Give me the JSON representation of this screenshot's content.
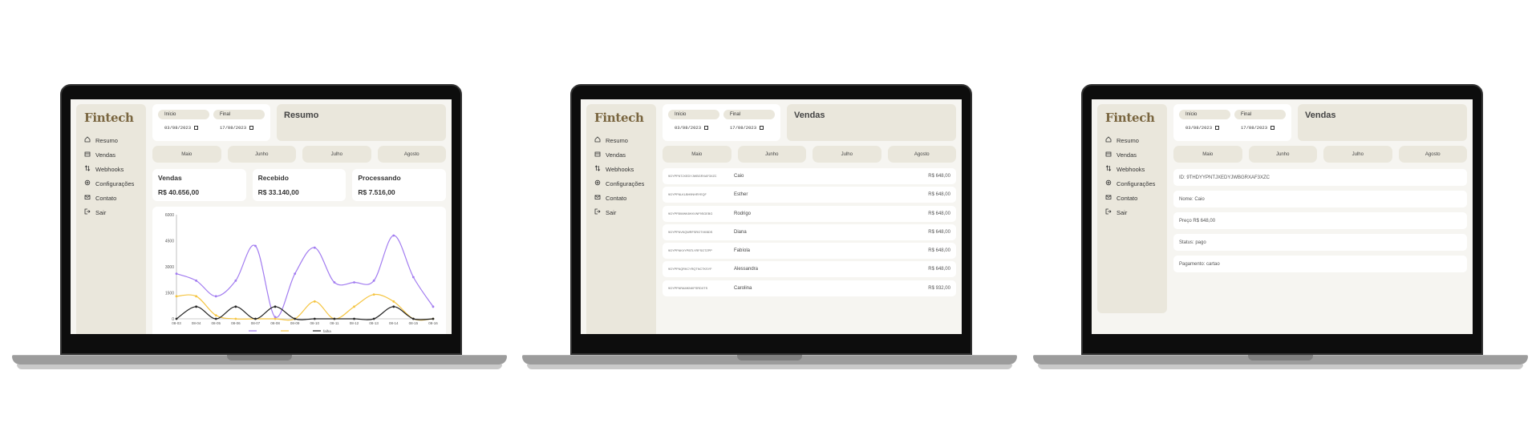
{
  "app": {
    "logo": "Fintech"
  },
  "nav": [
    {
      "label": "Resumo",
      "icon": "home-icon"
    },
    {
      "label": "Vendas",
      "icon": "sales-icon"
    },
    {
      "label": "Webhooks",
      "icon": "webhook-arrows-icon"
    },
    {
      "label": "Configurações",
      "icon": "gear-icon"
    },
    {
      "label": "Contato",
      "icon": "mail-icon"
    },
    {
      "label": "Sair",
      "icon": "logout-icon"
    }
  ],
  "filters": {
    "start_label": "Início",
    "start_value": "03/08/2023",
    "end_label": "Final",
    "end_value": "17/08/2023"
  },
  "months": [
    "Maio",
    "Junho",
    "Julho",
    "Agosto"
  ],
  "screen1": {
    "title": "Resumo",
    "cards": [
      {
        "title": "Vendas",
        "value": "R$ 40.656,00"
      },
      {
        "title": "Recebido",
        "value": "R$ 33.140,00"
      },
      {
        "title": "Processando",
        "value": "R$ 7.516,00"
      }
    ]
  },
  "screen2": {
    "title": "Vendas",
    "rows": [
      {
        "id": "9GYPFNTJXEDYJWBGRXAF3XZC",
        "name": "Caio",
        "price": "R$ 648,00"
      },
      {
        "id": "9GYPFNLKLBH9NHRYEQF",
        "name": "Esther",
        "price": "R$ 648,00"
      },
      {
        "id": "9GYPFBWWK8HXVNF9SGEBG",
        "name": "Rodrigo",
        "price": "R$ 648,00"
      },
      {
        "id": "9GYPFNVKQWRFSRGTXKBDS",
        "name": "Diana",
        "price": "R$ 648,00"
      },
      {
        "id": "9GYPFNKVYPBTLYRFSGTZPP",
        "name": "Fabíola",
        "price": "R$ 648,00"
      },
      {
        "id": "9GYPFNQRKCYRQTNCTKSYF",
        "name": "Alessandra",
        "price": "R$ 648,00"
      },
      {
        "id": "9GYPFNRAMKNKFSRDXTS",
        "name": "Carolina",
        "price": "R$ 932,00"
      }
    ]
  },
  "screen3": {
    "title": "Vendas",
    "rows": [
      "ID: 9THDYYPNTJXEDYJWBGRXAF3XZC",
      "Nome: Caio",
      "Preço R$ 648,00",
      "Status: pago",
      "Pagamento: cartao"
    ]
  },
  "chart_data": {
    "type": "line",
    "x": [
      "08-03",
      "08-04",
      "08-05",
      "08-06",
      "08-07",
      "08-08",
      "08-09",
      "08-10",
      "08-11",
      "08-12",
      "08-13",
      "08-14",
      "08-15",
      "08-16"
    ],
    "y_ticks": [
      0,
      1500,
      3000,
      4500,
      6000
    ],
    "ylim": [
      0,
      6000
    ],
    "series": [
      {
        "name": "",
        "color": "#a27cf0",
        "values": [
          2600,
          2200,
          1300,
          2200,
          4200,
          100,
          2600,
          4100,
          2100,
          2100,
          2200,
          4800,
          2400,
          700
        ]
      },
      {
        "name": "",
        "color": "#f5c542",
        "values": [
          1300,
          1300,
          200,
          0,
          0,
          0,
          0,
          1000,
          0,
          700,
          1400,
          1000,
          0,
          0
        ]
      },
      {
        "name": "falha",
        "color": "#222222",
        "values": [
          0,
          700,
          0,
          700,
          0,
          700,
          0,
          0,
          0,
          0,
          0,
          700,
          0,
          0
        ]
      }
    ],
    "legend": [
      {
        "label": "",
        "color": "#a27cf0"
      },
      {
        "label": "",
        "color": "#f5c542"
      },
      {
        "label": "falha",
        "color": "#222222"
      }
    ]
  }
}
